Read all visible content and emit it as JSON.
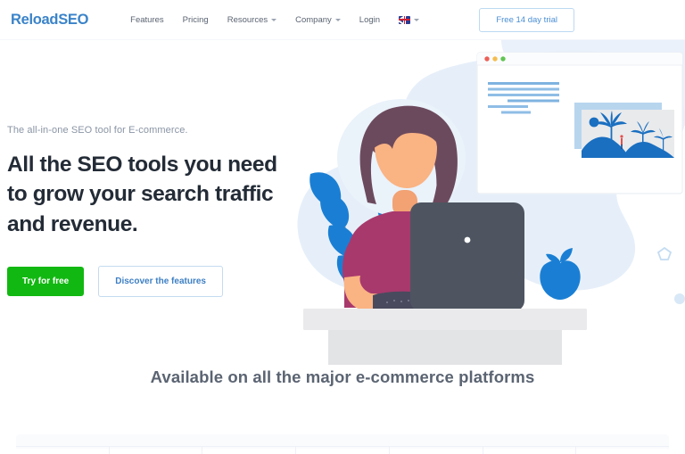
{
  "header": {
    "logo": "ReloadSEO",
    "nav": [
      {
        "label": "Features",
        "has_caret": false
      },
      {
        "label": "Pricing",
        "has_caret": false
      },
      {
        "label": "Resources",
        "has_caret": true
      },
      {
        "label": "Company",
        "has_caret": true
      },
      {
        "label": "Login",
        "has_caret": false
      }
    ],
    "language": {
      "icon": "uk-flag-icon",
      "has_caret": true
    },
    "trial_button": "Free 14 day trial"
  },
  "hero": {
    "eyebrow": "The all-in-one SEO tool for E-commerce.",
    "headline": "All the SEO tools you need to grow your search traffic and revenue.",
    "primary_cta": "Try for free",
    "secondary_cta": "Discover the features"
  },
  "platforms": {
    "title": "Available on all the major e-commerce platforms",
    "cells": 7
  },
  "colors": {
    "brand_blue": "#3a83c9",
    "link_blue": "#4a8fd4",
    "cta_green": "#12b812",
    "headline_dark": "#232b36",
    "muted_text": "#5b6472",
    "blob_light_blue": "#e4eef8",
    "illustration_blue": "#1a7fd4",
    "laptop_gray": "#4e5561",
    "desk_gray": "#e3e4e6",
    "skin": "#fab383",
    "hair": "#6c4a5d",
    "shirt": "#a8396d",
    "border_light": "#bcd9f2"
  },
  "illustration": {
    "name": "woman-at-desk-with-laptop-illustration",
    "browser_mockup": {
      "traffic_lights": [
        "#ee5f56",
        "#f5bd4f",
        "#61c554"
      ],
      "content": "text-lines-and-palm-tree-image"
    },
    "elements": [
      "background-blob",
      "leafy-plant",
      "woman",
      "laptop",
      "apple",
      "desk",
      "browser-window",
      "pentagon-outline",
      "small-dot"
    ]
  }
}
